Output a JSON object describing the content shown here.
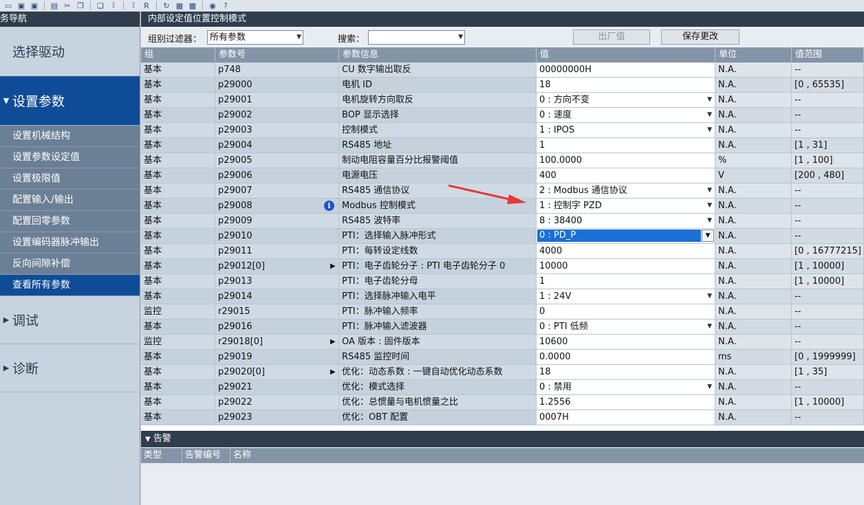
{
  "toolbar": {
    "icons": [
      "new-icon",
      "save-icon",
      "save-all-icon",
      "print-icon",
      "cut-icon",
      "copy-icon",
      "paste-icon",
      "connect-icon",
      "disconnect-icon",
      "rom-icon",
      "refresh-icon",
      "table-icon",
      "chart-icon",
      "plug-icon",
      "help-icon"
    ],
    "icon_glyphs": [
      "▭",
      "▣",
      "▣",
      "▤",
      "✂",
      "❐",
      "❏",
      "⟟",
      "⟟",
      "R",
      "↻",
      "▦",
      "▩",
      "◉",
      "?"
    ]
  },
  "nav": {
    "header": "任务导航",
    "header_visible": "务导航",
    "select_drive": "选择驱动",
    "set_params": "设置参数",
    "sub_items": [
      "设置机械结构",
      "设置参数设定值",
      "设置极限值",
      "配置输入/输出",
      "配置回零参数",
      "设置编码器脉冲输出",
      "反向间隙补偿",
      "查看所有参数"
    ],
    "debug": "调试",
    "diagnose": "诊断"
  },
  "main": {
    "title": "内部设定值位置控制模式",
    "filter_label": "组别过滤器：",
    "filter_value": "所有参数",
    "search_label": "搜索：",
    "search_value": "",
    "factory_button": "出厂值",
    "save_button": "保存更改"
  },
  "table": {
    "headers": [
      "组",
      "参数号",
      "参数信息",
      "值",
      "单位",
      "值范围"
    ],
    "rows": [
      {
        "group": "基本",
        "num": "p748",
        "info": "CU 数字输出取反",
        "value": "00000000H",
        "unit": "N.A.",
        "range": "--",
        "dropdown": false
      },
      {
        "group": "基本",
        "num": "p29000",
        "info": "电机 ID",
        "value": "18",
        "unit": "N.A.",
        "range": "[0 , 65535]",
        "dropdown": false
      },
      {
        "group": "基本",
        "num": "p29001",
        "info": "电机旋转方向取反",
        "value": "0 : 方向不变",
        "unit": "N.A.",
        "range": "--",
        "dropdown": true
      },
      {
        "group": "基本",
        "num": "p29002",
        "info": "BOP 显示选择",
        "value": "0 : 速度",
        "unit": "N.A.",
        "range": "--",
        "dropdown": true
      },
      {
        "group": "基本",
        "num": "p29003",
        "info": "控制模式",
        "value": "1 : IPOS",
        "unit": "N.A.",
        "range": "--",
        "dropdown": true
      },
      {
        "group": "基本",
        "num": "p29004",
        "info": "RS485 地址",
        "value": "1",
        "unit": "N.A.",
        "range": "[1 , 31]",
        "dropdown": false
      },
      {
        "group": "基本",
        "num": "p29005",
        "info": "制动电阻容量百分比报警阈值",
        "value": "100.0000",
        "unit": "%",
        "range": "[1 , 100]",
        "dropdown": false
      },
      {
        "group": "基本",
        "num": "p29006",
        "info": "电源电压",
        "value": "400",
        "unit": "V",
        "range": "[200 , 480]",
        "dropdown": false
      },
      {
        "group": "基本",
        "num": "p29007",
        "info": "RS485 通信协议",
        "value": "2 : Modbus 通信协议",
        "unit": "N.A.",
        "range": "--",
        "dropdown": true
      },
      {
        "group": "基本",
        "num": "p29008",
        "info": "Modbus 控制模式",
        "value": "1 : 控制字 PZD",
        "unit": "N.A.",
        "range": "--",
        "dropdown": true,
        "info_icon": true
      },
      {
        "group": "基本",
        "num": "p29009",
        "info": "RS485 波特率",
        "value": "8 : 38400",
        "unit": "N.A.",
        "range": "--",
        "dropdown": true
      },
      {
        "group": "基本",
        "num": "p29010",
        "info": "PTI：选择输入脉冲形式",
        "value": "0 : PD_P",
        "unit": "N.A.",
        "range": "--",
        "dropdown": true,
        "selected": true
      },
      {
        "group": "基本",
        "num": "p29011",
        "info": "PTI：每转设定线数",
        "value": "4000",
        "unit": "N.A.",
        "range": "[0 , 16777215]",
        "dropdown": false
      },
      {
        "group": "基本",
        "num": "p29012[0]",
        "info": "PTI：电子齿轮分子 : PTI 电子齿轮分子 0",
        "value": "10000",
        "unit": "N.A.",
        "range": "[1 , 10000]",
        "dropdown": false,
        "expand": true
      },
      {
        "group": "基本",
        "num": "p29013",
        "info": "PTI：电子齿轮分母",
        "value": "1",
        "unit": "N.A.",
        "range": "[1 , 10000]",
        "dropdown": false
      },
      {
        "group": "基本",
        "num": "p29014",
        "info": "PTI：选择脉冲输入电平",
        "value": "1 : 24V",
        "unit": "N.A.",
        "range": "--",
        "dropdown": true
      },
      {
        "group": "监控",
        "num": "r29015",
        "info": "PTI：脉冲输入频率",
        "value": "0",
        "unit": "N.A.",
        "range": "--",
        "dropdown": false
      },
      {
        "group": "基本",
        "num": "p29016",
        "info": "PTI：脉冲输入滤波器",
        "value": "0 : PTI 低频",
        "unit": "N.A.",
        "range": "--",
        "dropdown": true
      },
      {
        "group": "监控",
        "num": "r29018[0]",
        "info": "OA 版本 : 固件版本",
        "value": "10600",
        "unit": "N.A.",
        "range": "--",
        "dropdown": false,
        "expand": true
      },
      {
        "group": "基本",
        "num": "p29019",
        "info": "RS485 监控时间",
        "value": "0.0000",
        "unit": "ms",
        "range": "[0 , 1999999]",
        "dropdown": false
      },
      {
        "group": "基本",
        "num": "p29020[0]",
        "info": "优化：动态系数 : 一键自动优化动态系数",
        "value": "18",
        "unit": "N.A.",
        "range": "[1 , 35]",
        "dropdown": false,
        "expand": true
      },
      {
        "group": "基本",
        "num": "p29021",
        "info": "优化：模式选择",
        "value": "0 : 禁用",
        "unit": "N.A.",
        "range": "--",
        "dropdown": true
      },
      {
        "group": "基本",
        "num": "p29022",
        "info": "优化：总惯量与电机惯量之比",
        "value": "1.2556",
        "unit": "N.A.",
        "range": "[1 , 10000]",
        "dropdown": false
      },
      {
        "group": "基本",
        "num": "p29023",
        "info": "优化：OBT 配置",
        "value": "0007H",
        "unit": "N.A.",
        "range": "--",
        "dropdown": false
      }
    ]
  },
  "alarm": {
    "title": "告警",
    "columns": [
      "类型",
      "告警编号",
      "名称"
    ]
  },
  "colors": {
    "accent": "#0f4c97",
    "header_dark": "#2f3d4e",
    "selection": "#1b6fd6",
    "annotation_arrow": "#e53935"
  }
}
